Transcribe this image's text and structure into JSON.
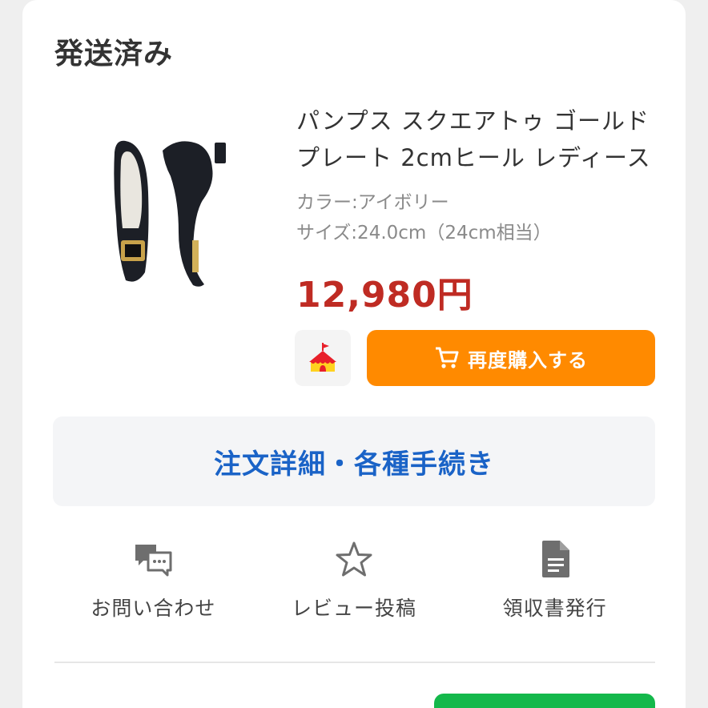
{
  "order": {
    "status": "発送済み"
  },
  "product": {
    "name": "パンプス スクエアトゥ ゴールドプレート 2cmヒール レディース",
    "color_label": "カラー:アイボリー",
    "size_label": "サイズ:24.0cm（24cm相当）",
    "price": "12,980円"
  },
  "buttons": {
    "rebuy_label": "再度購入する",
    "detail_label": "注文詳細・各種手続き"
  },
  "actions": [
    {
      "label": "お問い合わせ",
      "icon": "chat-bubbles-icon"
    },
    {
      "label": "レビュー投稿",
      "icon": "star-icon"
    },
    {
      "label": "領収書発行",
      "icon": "document-icon"
    }
  ],
  "colors": {
    "accent_orange": "#ff8a00",
    "price_red": "#bf2b23",
    "link_blue": "#1a63c7",
    "green": "#14b84b"
  }
}
